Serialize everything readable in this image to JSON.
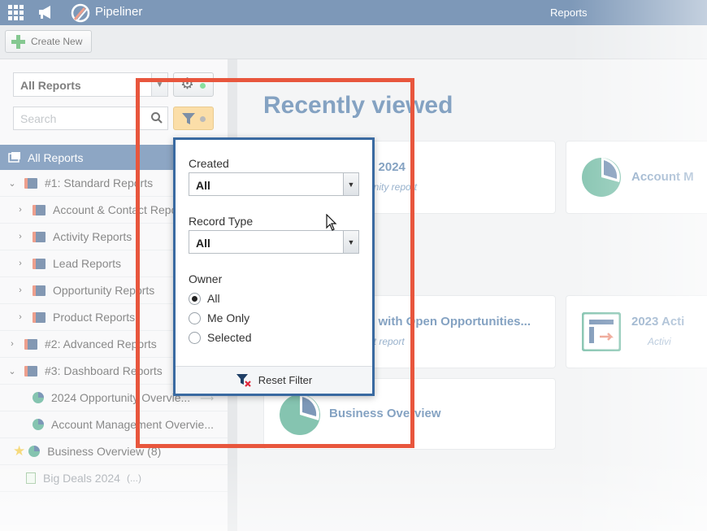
{
  "header": {
    "app_name": "Pipeliner",
    "page_title": "Reports"
  },
  "toolbar": {
    "create_label": "Create New"
  },
  "sidebar": {
    "view_select": "All Reports",
    "search_placeholder": "Search",
    "tree_header": "All Reports",
    "items": [
      {
        "label": "#1: Standard Reports"
      },
      {
        "label": "Account & Contact Reports"
      },
      {
        "label": "Activity Reports"
      },
      {
        "label": "Lead Reports"
      },
      {
        "label": "Opportunity Reports"
      },
      {
        "label": "Product Reports"
      },
      {
        "label": "#2: Advanced Reports"
      },
      {
        "label": "#3: Dashboard Reports"
      },
      {
        "label": "2024 Opportunity Overvie..."
      },
      {
        "label": "Account Management Overvie..."
      },
      {
        "label": "Business Overview (8)"
      },
      {
        "label": "Big Deals 2024",
        "badge": "(...)"
      }
    ]
  },
  "main": {
    "section_title": "Recently viewed",
    "cards": [
      {
        "title": "s 2024",
        "subtitle": "unity report"
      },
      {
        "title": "Account M"
      },
      {
        "title": "s with Open Opportunities...",
        "subtitle": "nt report"
      },
      {
        "title": "2023 Acti",
        "subtitle": "Activi"
      },
      {
        "title": "Business Overview"
      }
    ]
  },
  "filter_popup": {
    "created_label": "Created",
    "created_value": "All",
    "record_type_label": "Record Type",
    "record_type_value": "All",
    "owner_label": "Owner",
    "owner_options": [
      "All",
      "Me Only",
      "Selected"
    ],
    "owner_selected": "All",
    "reset_label": "Reset Filter"
  },
  "colors": {
    "topbar": "#1f4f86",
    "accent": "#2c5f96",
    "highlight": "#e8563d",
    "filter_active": "#f9c76a"
  }
}
